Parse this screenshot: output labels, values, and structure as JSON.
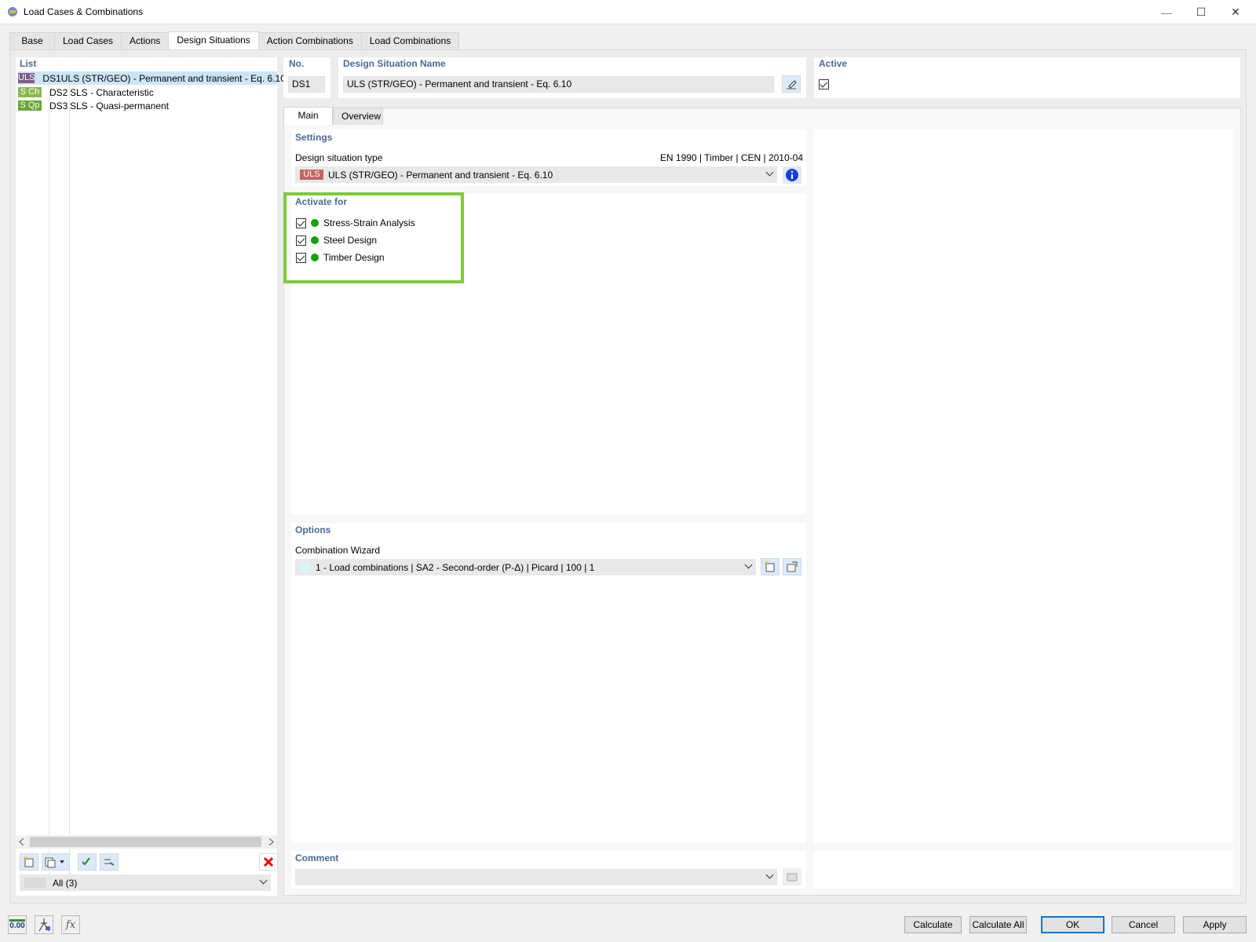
{
  "window": {
    "title": "Load Cases & Combinations",
    "controls": {
      "minimize": "—",
      "maximize": "☐",
      "close": "✕"
    }
  },
  "tabs": [
    "Base",
    "Load Cases",
    "Actions",
    "Design Situations",
    "Action Combinations",
    "Load Combinations"
  ],
  "active_tab": "Design Situations",
  "list": {
    "title": "List",
    "items": [
      {
        "badge": "ULS",
        "badge_color": "#7b5c8e",
        "no": "DS1",
        "name": "ULS (STR/GEO) - Permanent and transient - Eq. 6.10",
        "selected": true
      },
      {
        "badge": "S Ch",
        "badge_color": "#8ab94a",
        "no": "DS2",
        "name": "SLS - Characteristic",
        "selected": false
      },
      {
        "badge": "S Qp",
        "badge_color": "#6aa63a",
        "no": "DS3",
        "name": "SLS - Quasi-permanent",
        "selected": false
      }
    ],
    "filter": "All (3)",
    "toolbar_icons": [
      "new-item-icon",
      "copy-item-icon",
      "dropdown-arrow-icon",
      "check-all-icon",
      "uncheck-icon",
      "delete-icon"
    ]
  },
  "header": {
    "no_label": "No.",
    "no_value": "DS1",
    "name_label": "Design Situation Name",
    "name_value": "ULS (STR/GEO) - Permanent and transient - Eq. 6.10",
    "active_label": "Active",
    "active_checked": true
  },
  "subtabs": [
    "Main",
    "Overview"
  ],
  "active_subtab": "Main",
  "settings": {
    "title": "Settings",
    "type_label": "Design situation type",
    "standard": "EN 1990 | Timber | CEN | 2010-04",
    "type_badge": "ULS",
    "type_badge_color": "#c86464",
    "type_value": "ULS (STR/GEO) - Permanent and transient - Eq. 6.10"
  },
  "activate_for": {
    "title": "Activate for",
    "highlight_color": "#7dcc3a",
    "items": [
      {
        "label": "Stress-Strain Analysis",
        "checked": true
      },
      {
        "label": "Steel Design",
        "checked": true
      },
      {
        "label": "Timber Design",
        "checked": true
      }
    ]
  },
  "options": {
    "title": "Options",
    "wizard_label": "Combination Wizard",
    "wizard_value": "1 - Load combinations | SA2 - Second-order (P-Δ) | Picard | 100 | 1"
  },
  "comment": {
    "title": "Comment",
    "value": ""
  },
  "footer": {
    "icons": [
      "units-icon",
      "model-icon",
      "formula-icon"
    ],
    "units_label": "0.00",
    "buttons": {
      "calculate": "Calculate",
      "calculate_all": "Calculate All",
      "ok": "OK",
      "cancel": "Cancel",
      "apply": "Apply"
    }
  }
}
